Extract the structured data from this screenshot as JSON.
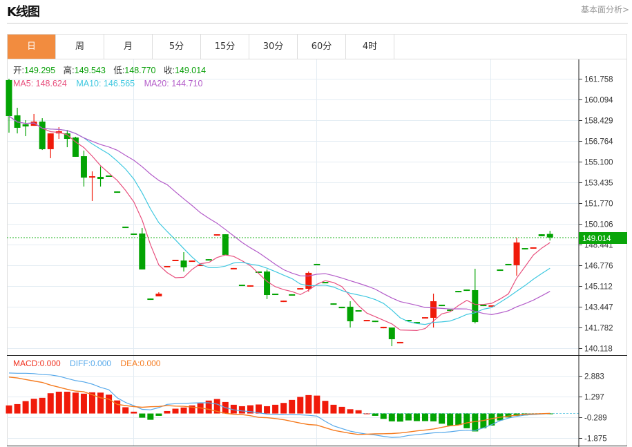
{
  "header": {
    "title": "K线图",
    "link": "基本面分析>"
  },
  "tabs": [
    {
      "label": "日",
      "active": true
    },
    {
      "label": "周"
    },
    {
      "label": "月"
    },
    {
      "label": "5分"
    },
    {
      "label": "15分"
    },
    {
      "label": "30分"
    },
    {
      "label": "60分"
    },
    {
      "label": "4时"
    }
  ],
  "ohlc": {
    "open_label": "开:",
    "open": "149.295",
    "high_label": "高:",
    "high": "149.543",
    "low_label": "低:",
    "low": "148.770",
    "close_label": "收:",
    "close": "149.014"
  },
  "ma": {
    "ma5": "MA5: 148.624",
    "ma10": "MA10: 146.565",
    "ma20": "MA20: 144.710"
  },
  "macd_legend": {
    "macd": "MACD:0.000",
    "diff": "DIFF:0.000",
    "dea": "DEA:0.000"
  },
  "colors": {
    "up": "#F01A0A",
    "down": "#03A303",
    "ma5": "#E8507E",
    "ma10": "#3FC8E0",
    "ma20": "#B35CC9",
    "diff": "#55A8EA",
    "dea": "#F57B1F",
    "accent": "#F28C3F"
  },
  "chart_data": {
    "type": "candlestick",
    "price_axis_ticks": [
      "161.758",
      "160.094",
      "158.429",
      "156.764",
      "155.100",
      "153.435",
      "151.770",
      "150.106",
      "148.441",
      "146.776",
      "145.112",
      "143.447",
      "141.782",
      "140.118"
    ],
    "price_range": [
      140.118,
      161.758
    ],
    "current_price": "149.014",
    "candles_ohlc": [
      [
        161.65,
        161.76,
        157.43,
        158.76
      ],
      [
        158.82,
        159.43,
        157.37,
        157.82
      ],
      [
        158.1,
        158.43,
        157.15,
        157.93
      ],
      [
        157.98,
        158.93,
        157.98,
        158.32
      ],
      [
        158.32,
        158.59,
        156.04,
        156.1
      ],
      [
        156.1,
        157.37,
        155.38,
        157.37
      ],
      [
        157.37,
        157.87,
        156.93,
        157.54
      ],
      [
        157.37,
        157.65,
        156.26,
        156.93
      ],
      [
        157.04,
        157.1,
        155.49,
        155.49
      ],
      [
        155.54,
        155.99,
        153.1,
        153.82
      ],
      [
        153.82,
        154.32,
        151.94,
        153.93
      ],
      [
        153.88,
        154.71,
        153.1,
        153.71
      ],
      [
        153.99,
        153.99,
        153.93,
        153.93
      ],
      [
        152.71,
        152.71,
        152.6,
        152.6
      ],
      [
        149.88,
        149.88,
        149.82,
        149.82
      ],
      [
        149.33,
        149.33,
        149.27,
        149.27
      ],
      [
        149.33,
        149.77,
        146.44,
        146.44
      ],
      [
        144.11,
        144.11,
        144.0,
        144.0
      ],
      [
        144.28,
        144.61,
        144.28,
        144.5
      ],
      [
        146.61,
        146.72,
        146.61,
        146.72
      ],
      [
        147.16,
        147.22,
        147.16,
        147.22
      ],
      [
        147.16,
        147.83,
        146.28,
        146.61
      ],
      [
        147.11,
        147.16,
        147.11,
        147.16
      ],
      [
        146.78,
        146.83,
        146.78,
        146.83
      ],
      [
        147.27,
        147.27,
        147.16,
        147.16
      ],
      [
        149.22,
        149.27,
        149.22,
        149.27
      ],
      [
        149.27,
        149.27,
        147.61,
        147.61
      ],
      [
        146.5,
        146.56,
        146.5,
        146.56
      ],
      [
        145.22,
        145.22,
        145.11,
        145.11
      ],
      [
        145.06,
        145.17,
        145.06,
        145.17
      ],
      [
        146.28,
        146.28,
        146.17,
        146.17
      ],
      [
        146.28,
        146.44,
        144.06,
        144.39
      ],
      [
        144.5,
        144.5,
        144.45,
        144.45
      ],
      [
        143.83,
        143.94,
        143.83,
        143.94
      ],
      [
        144.45,
        144.45,
        144.39,
        144.39
      ],
      [
        144.89,
        144.94,
        144.89,
        144.94
      ],
      [
        144.89,
        146.28,
        144.67,
        146.17
      ],
      [
        146.89,
        146.89,
        146.83,
        146.83
      ],
      [
        145.44,
        145.44,
        145.39,
        145.39
      ],
      [
        143.72,
        143.72,
        143.61,
        143.61
      ],
      [
        143.45,
        143.45,
        143.33,
        143.33
      ],
      [
        143.45,
        143.89,
        141.78,
        142.28
      ],
      [
        143.17,
        143.17,
        143.06,
        143.06
      ],
      [
        142.33,
        142.39,
        142.33,
        142.39
      ],
      [
        142.33,
        142.33,
        142.22,
        142.22
      ],
      [
        141.72,
        141.84,
        141.72,
        141.84
      ],
      [
        141.78,
        141.78,
        140.28,
        140.84
      ],
      [
        140.56,
        140.62,
        140.56,
        140.62
      ],
      [
        142.39,
        142.39,
        142.28,
        142.28
      ],
      [
        142.22,
        142.22,
        142.11,
        142.11
      ],
      [
        142.56,
        142.61,
        142.56,
        142.61
      ],
      [
        142.56,
        144.5,
        141.78,
        143.89
      ],
      [
        143.61,
        143.61,
        143.5,
        143.5
      ],
      [
        143.22,
        143.22,
        143.11,
        143.11
      ],
      [
        144.72,
        144.72,
        144.61,
        144.61
      ],
      [
        144.83,
        144.83,
        144.72,
        144.72
      ],
      [
        144.78,
        146.5,
        142.11,
        142.22
      ],
      [
        143.61,
        143.61,
        143.5,
        143.5
      ],
      [
        143.5,
        143.56,
        143.5,
        143.56
      ],
      [
        146.44,
        146.44,
        146.33,
        146.33
      ],
      [
        146.89,
        146.89,
        146.78,
        146.78
      ],
      [
        146.78,
        149.0,
        145.94,
        148.61
      ],
      [
        148.16,
        148.16,
        148.05,
        148.05
      ],
      [
        148.11,
        148.22,
        148.11,
        148.22
      ],
      [
        149.27,
        149.27,
        149.11,
        149.11
      ],
      [
        149.295,
        149.543,
        148.77,
        149.014
      ]
    ],
    "macd_axis_ticks": [
      "2.883",
      "1.297",
      "-0.289",
      "-1.875"
    ],
    "macd_range": [
      -1.875,
      2.883
    ],
    "macd_hist": [
      0.62,
      0.72,
      0.95,
      1.13,
      1.2,
      1.55,
      1.67,
      1.67,
      1.6,
      1.52,
      1.62,
      1.6,
      1.44,
      1.0,
      0.48,
      0.14,
      -0.32,
      -0.48,
      -0.18,
      0.19,
      0.37,
      0.46,
      0.62,
      0.78,
      0.99,
      1.11,
      0.88,
      0.67,
      0.56,
      0.63,
      0.69,
      0.56,
      0.67,
      0.81,
      1.04,
      1.27,
      1.41,
      1.37,
      0.97,
      0.67,
      0.51,
      0.33,
      0.25,
      0.0,
      -0.18,
      -0.41,
      -0.6,
      -0.62,
      -0.53,
      -0.58,
      -0.58,
      -0.6,
      -0.78,
      -0.92,
      -0.88,
      -1.13,
      -1.37,
      -1.13,
      -0.92,
      -0.53,
      -0.3,
      -0.18,
      -0.14,
      -0.09,
      -0.05,
      -0.02
    ],
    "diff": [
      3.1,
      3.08,
      3.08,
      3.05,
      2.98,
      2.95,
      2.85,
      2.68,
      2.52,
      2.42,
      2.25,
      2.0,
      1.82,
      1.2,
      0.85,
      0.6,
      0.32,
      0.28,
      0.45,
      0.7,
      0.75,
      0.78,
      0.8,
      0.82,
      0.82,
      0.72,
      0.45,
      0.28,
      0.2,
      0.15,
      0.05,
      -0.04,
      -0.05,
      -0.07,
      -0.08,
      -0.1,
      -0.14,
      -0.2,
      -0.6,
      -0.95,
      -1.15,
      -1.35,
      -1.48,
      -1.58,
      -1.65,
      -1.75,
      -1.83,
      -1.8,
      -1.68,
      -1.62,
      -1.55,
      -1.48,
      -1.45,
      -1.4,
      -1.32,
      -1.28,
      -1.3,
      -1.1,
      -0.85,
      -0.55,
      -0.35,
      -0.22,
      -0.12,
      -0.08,
      -0.04,
      0.0
    ]
  }
}
